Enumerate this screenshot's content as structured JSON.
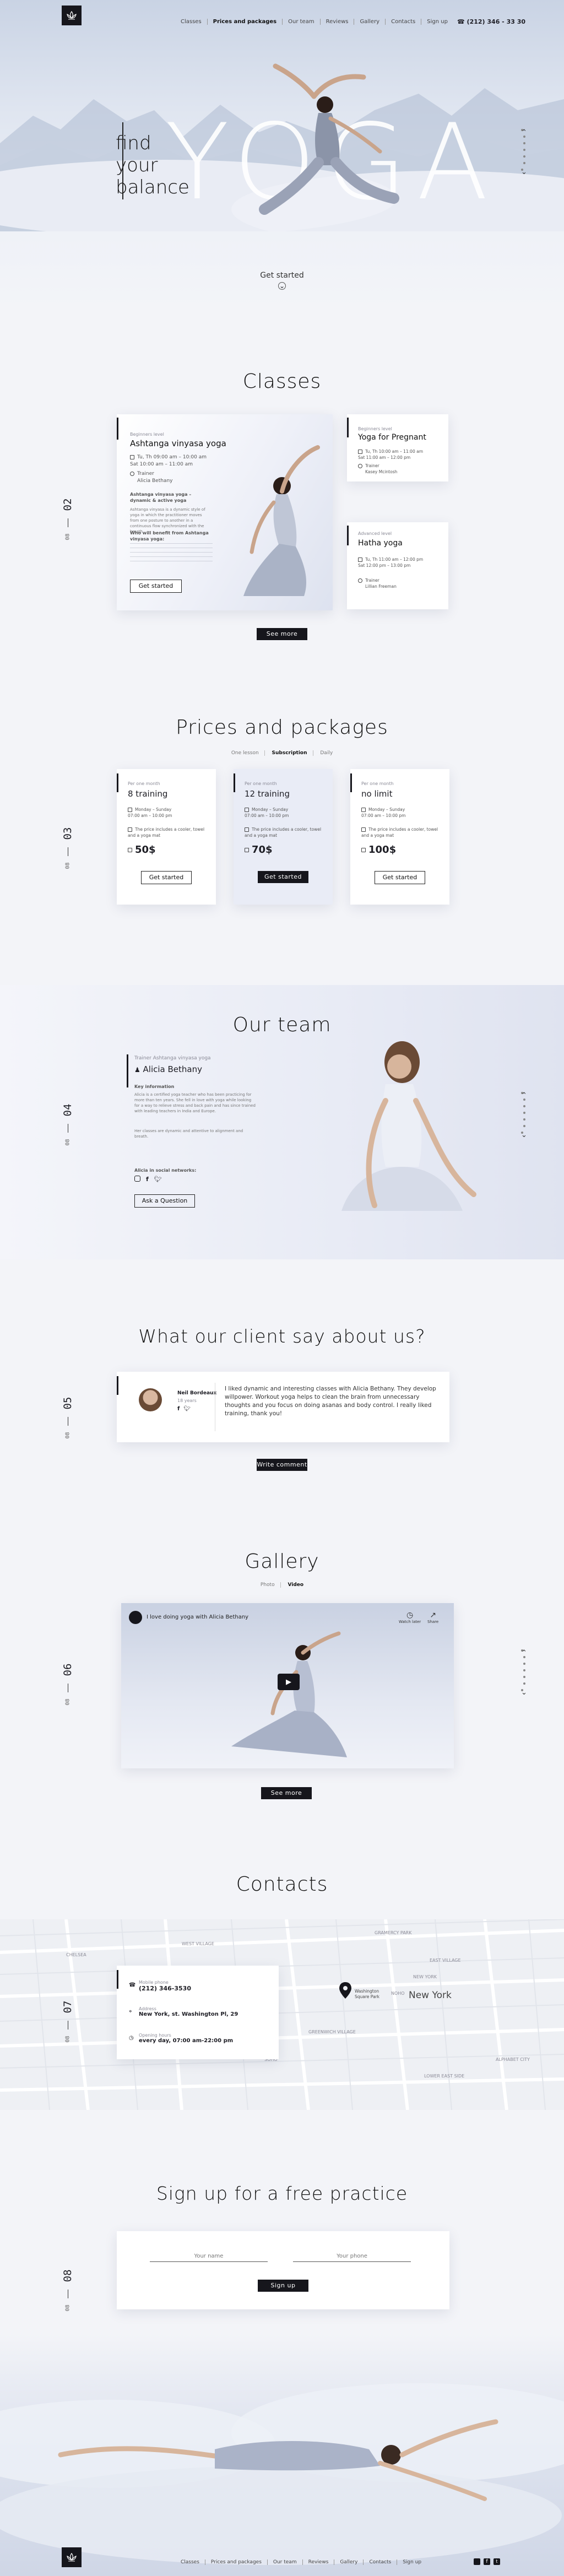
{
  "header": {
    "nav": [
      "Classes",
      "Prices and packages",
      "Our team",
      "Reviews",
      "Gallery",
      "Contacts",
      "Sign up"
    ],
    "active_index": 1,
    "phone": "(212) 346 - 33 30"
  },
  "hero": {
    "line1": "find",
    "line2": "your",
    "line3": "balance",
    "big": "YOGA",
    "cta": "Get started"
  },
  "classes": {
    "title": "Classes",
    "num": "02",
    "of": "08",
    "main": {
      "level": "Beginners level",
      "name": "Ashtanga vinyasa yoga",
      "schedule": "Tu, Th 09:00 am – 10:00 am\nSat 10:00 am – 11:00 am",
      "trainer_label": "Trainer",
      "trainer": "Alicia Bethany",
      "desc_title": "Ashtanga vinyasa yoga – dynamic & active yoga",
      "desc": "Ashtanga vinyasa is a dynamic style of yoga in which the practitioner moves from one posture to another in a continuous flow synchronized with the breath.",
      "who_title": "Who will benefit from Ashtanga vinyasa yoga:",
      "button": "Get started"
    },
    "side": [
      {
        "level": "Beginners level",
        "name": "Yoga for Pregnant",
        "schedule": "Tu, Th 10:00 am – 11:00 am\nSat 11:00 am – 12:00 pm",
        "trainer_label": "Trainer",
        "trainer": "Kasey Mcintosh"
      },
      {
        "level": "Advanced level",
        "name": "Hatha yoga",
        "schedule": "Tu, Th 11:00 am – 12:00 pm\nSat 12:00 pm – 13:00 pm",
        "trainer_label": "Trainer",
        "trainer": "Lillian Freeman"
      }
    ],
    "more": "See more"
  },
  "prices": {
    "title": "Prices and packages",
    "num": "03",
    "of": "08",
    "tabs": [
      "One lesson",
      "Subscription",
      "Daily"
    ],
    "active_tab": 1,
    "plans": [
      {
        "period": "Per one month",
        "name": "8 training",
        "days": "Monday – Sunday\n07:00 am – 10:00 pm",
        "note": "The price includes a cooler, towel and a yoga mat",
        "price": "50$",
        "button": "Get started"
      },
      {
        "period": "Per one month",
        "name": "12 training",
        "days": "Monday – Sunday\n07:00 am – 10:00 pm",
        "note": "The price includes a cooler, towel and a yoga mat",
        "price": "70$",
        "button": "Get started"
      },
      {
        "period": "Per one month",
        "name": "no limit",
        "days": "Monday – Sunday\n07:00 am – 10:00 pm",
        "note": "The price includes a cooler, towel and a yoga mat",
        "price": "100$",
        "button": "Get started"
      }
    ]
  },
  "team": {
    "title": "Our team",
    "num": "04",
    "of": "08",
    "role": "Trainer Ashtanga vinyasa yoga",
    "name": "Alicia Bethany",
    "key_label": "Key information",
    "bio1": "Alicia is a certified yoga teacher who has been practicing for more than ten years. She fell in love with yoga while looking for a way to relieve stress and back pain and has since trained with leading teachers in India and Europe.",
    "bio2": "Her classes are dynamic and attentive to alignment and breath.",
    "social_label": "Alicia in social networks:",
    "button": "Ask a Question"
  },
  "reviews": {
    "title": "What our client say about us?",
    "num": "05",
    "of": "08",
    "author": "Neil Bordeaux",
    "author_sub": "18 years",
    "text": "I liked dynamic and interesting classes with Alicia Bethany. They develop willpower. Workout yoga helps to clean the brain from unnecessary thoughts and you focus on doing asanas and body control. I really liked training, thank you!",
    "button": "Write comment"
  },
  "gallery": {
    "title": "Gallery",
    "num": "06",
    "of": "08",
    "tabs": [
      "Photo",
      "Video"
    ],
    "active_tab": 1,
    "video_title": "I love doing yoga with Alicia Bethany",
    "watch_later": "Watch later",
    "share": "Share",
    "more": "See more"
  },
  "contacts": {
    "title": "Contacts",
    "num": "07",
    "of": "08",
    "phone_label": "Mobile phone",
    "phone": "(212) 346-3530",
    "address_label": "Address",
    "address": "New York, st. Washington Pl, 29",
    "hours_label": "Opening hours",
    "hours": "every day, 07:00 am-22:00 pm",
    "map_pin": "Washington Square Park",
    "map_labels": [
      "WEST VILLAGE",
      "GREENWICH VILLAGE",
      "NOHO",
      "SOHO",
      "EAST VILLAGE",
      "LOWER EAST SIDE",
      "ALPHABET CITY",
      "CHELSEA",
      "NEW YORK",
      "GRAMERCY PARK"
    ],
    "city": "New York"
  },
  "signup": {
    "title": "Sign up for a free practice",
    "num": "08",
    "of": "08",
    "name_placeholder": "Your name",
    "phone_placeholder": "Your phone",
    "button": "Sign up"
  },
  "footer": {
    "nav": [
      "Classes",
      "Prices and packages",
      "Our team",
      "Reviews",
      "Gallery",
      "Contacts",
      "Sign up"
    ]
  },
  "colors": {
    "dark": "#16161c",
    "accent_bg": "#e8ebf6",
    "page": "#f3f4f8"
  },
  "icons": [
    "lotus-logo-icon",
    "phone-icon",
    "calendar-icon",
    "user-icon",
    "instagram-icon",
    "facebook-icon",
    "twitter-icon",
    "play-icon",
    "map-pin-icon",
    "clock-icon",
    "share-icon"
  ]
}
